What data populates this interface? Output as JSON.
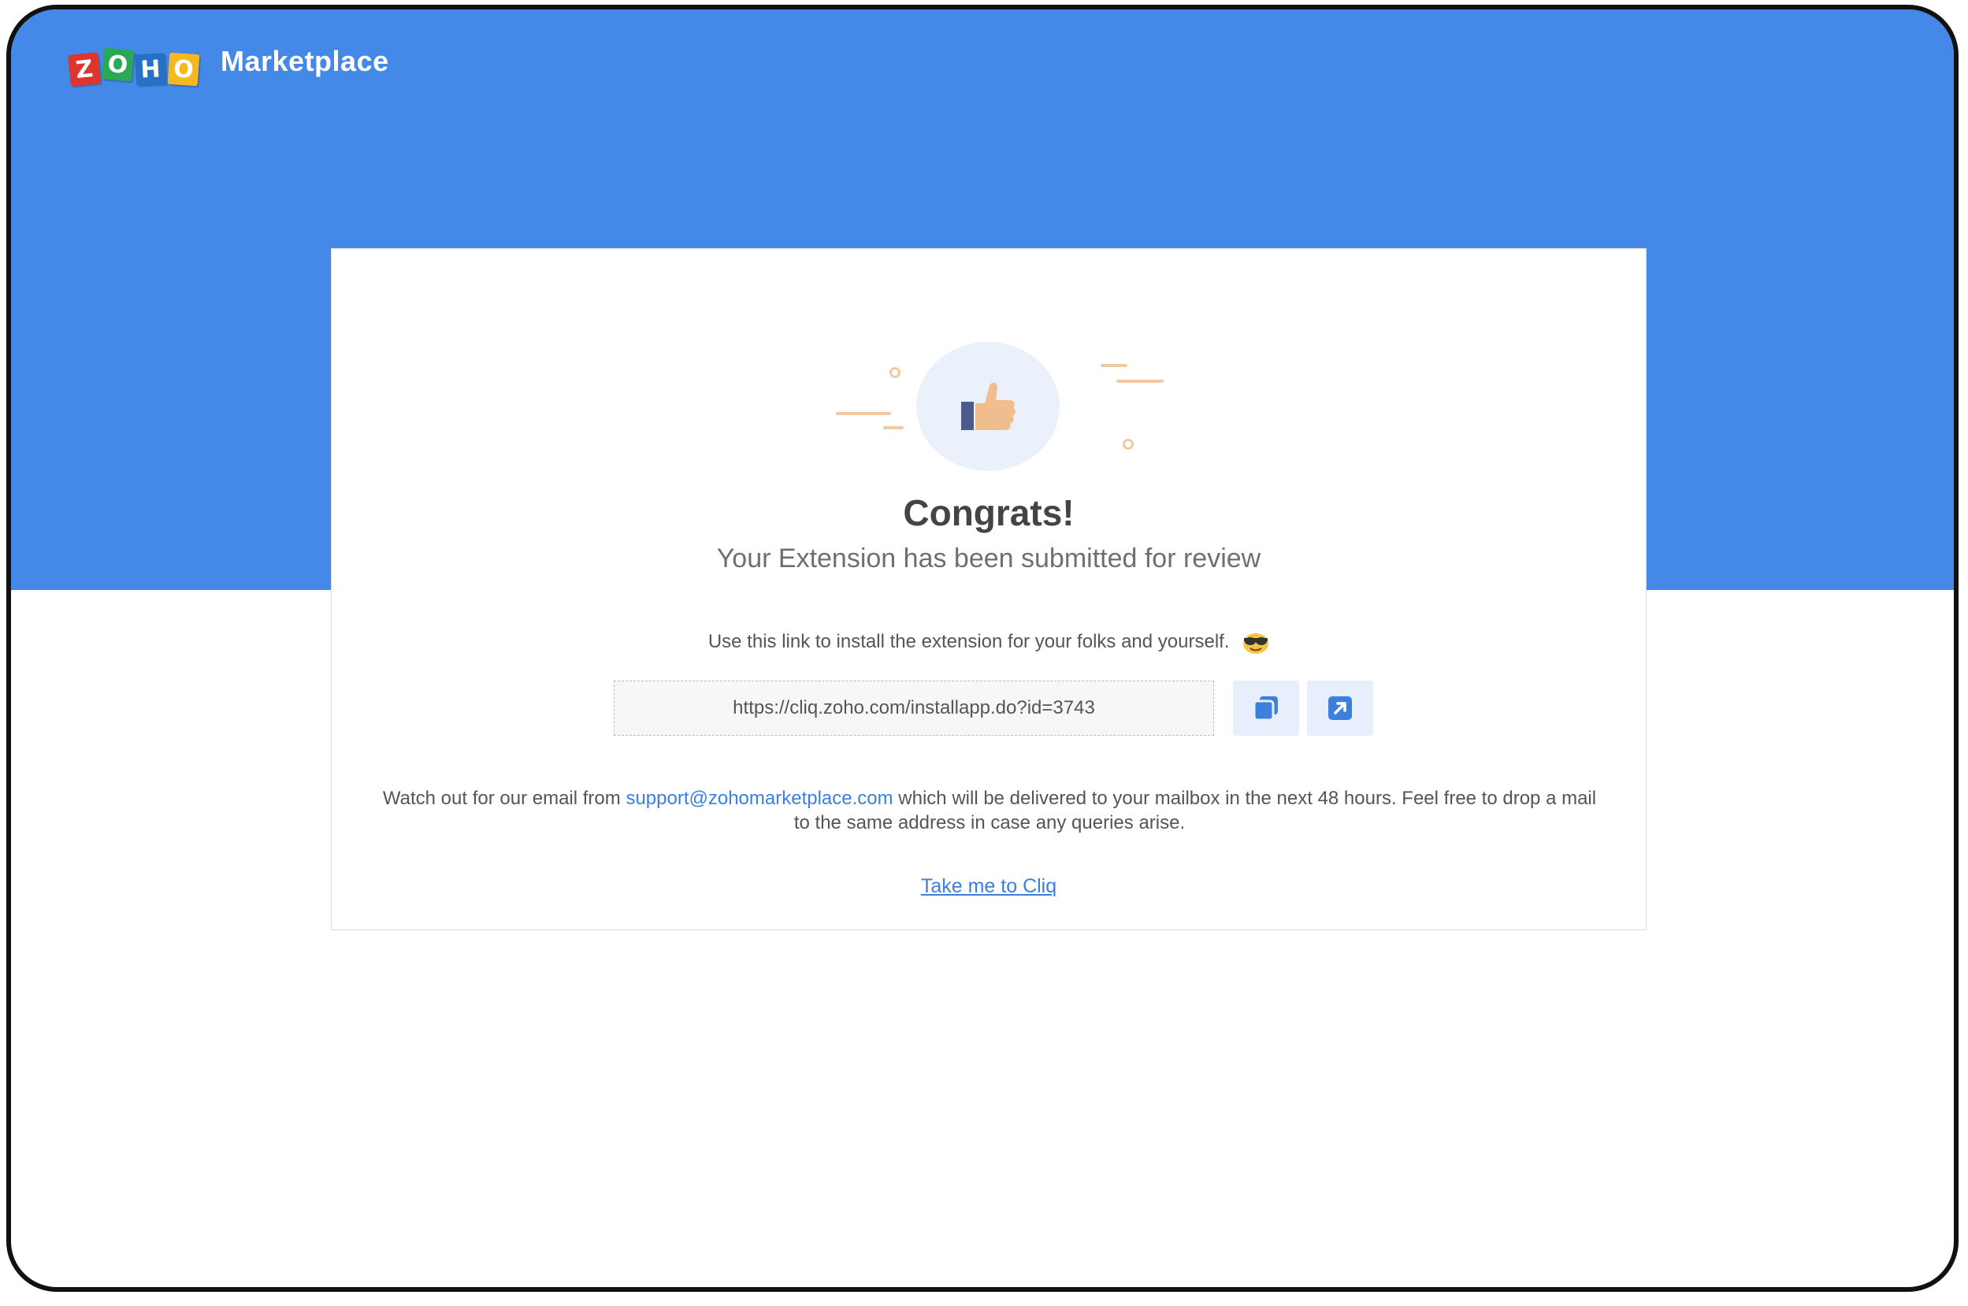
{
  "header": {
    "logo_letters": [
      "Z",
      "O",
      "H",
      "O"
    ],
    "brand_title": "Marketplace"
  },
  "card": {
    "title": "Congrats!",
    "subtitle": "Your Extension has been submitted for review",
    "hint": "Use this link to install the extension for your folks and yourself.",
    "install_link": "https://cliq.zoho.com/installapp.do?id=3743",
    "note_before": "Watch out for our email from",
    "support_email": "support@zohomarketplace.com",
    "note_after": "which will be delivered to your mailbox in the next 48 hours. Feel free to drop a mail to the same address in case any queries arise.",
    "cliq_link_label": "Take me to Cliq"
  },
  "icons": {
    "copy": "copy-icon",
    "open": "external-link-icon",
    "thumbs": "thumbs-up-icon",
    "emoji": "sunglasses-emoji-icon"
  },
  "colors": {
    "header_blue": "#4589e8",
    "link_blue": "#3c7fdc",
    "accent_peach": "#f3c9a2"
  }
}
